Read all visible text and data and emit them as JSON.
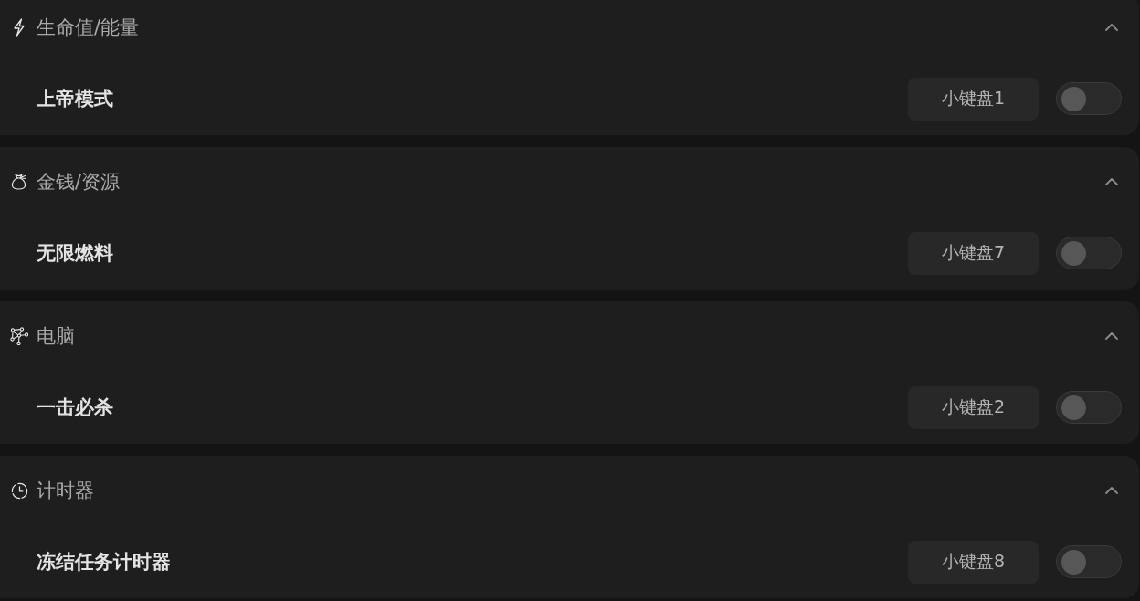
{
  "sections": [
    {
      "kind": "energy",
      "title": "生命值/能量",
      "expanded": true,
      "items": [
        {
          "label": "上帝模式",
          "hotkey": "小键盘1",
          "on": false
        }
      ]
    },
    {
      "kind": "money",
      "title": "金钱/资源",
      "expanded": true,
      "items": [
        {
          "label": "无限燃料",
          "hotkey": "小键盘7",
          "on": false
        }
      ]
    },
    {
      "kind": "computer",
      "title": "电脑",
      "expanded": true,
      "items": [
        {
          "label": "一击必杀",
          "hotkey": "小键盘2",
          "on": false
        }
      ]
    },
    {
      "kind": "timer",
      "title": "计时器",
      "expanded": true,
      "items": [
        {
          "label": "冻结任务计时器",
          "hotkey": "小键盘8",
          "on": false
        }
      ]
    }
  ]
}
